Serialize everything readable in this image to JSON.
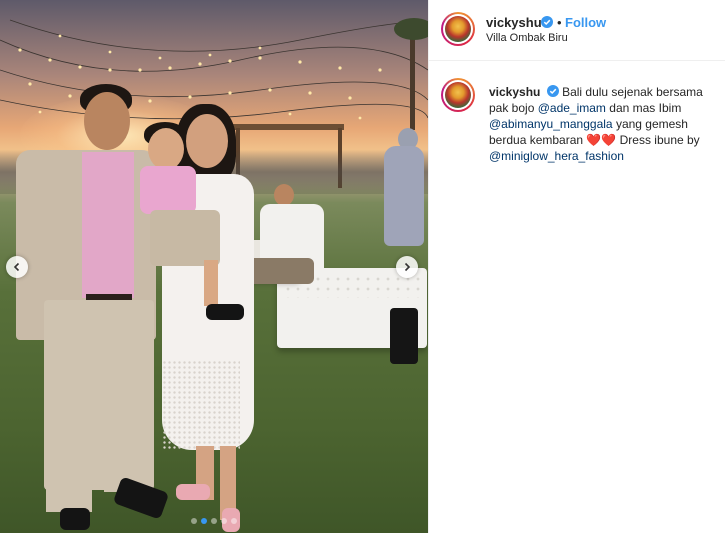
{
  "post": {
    "username": "vickyshu",
    "verified": true,
    "follow_separator": "•",
    "follow_label": "Follow",
    "location": "Villa Ombak Biru"
  },
  "caption": {
    "username": "vickyshu",
    "text_1": "Bali dulu sejenak bersama pak bojo",
    "mention_1": "@ade_imam",
    "text_2": "dan mas Ibim",
    "mention_2": "@abimanyu_manggala",
    "text_3": "yang gemesh berdua kembaran",
    "hearts": "❤️❤️",
    "text_4": "Dress ibune by",
    "mention_3": "@miniglow_hera_fashion"
  },
  "carousel": {
    "total_slides": 5,
    "active_index": 1
  },
  "icons": {
    "prev": "chevron-left-icon",
    "next": "chevron-right-icon",
    "verified": "verified-badge-icon"
  },
  "colors": {
    "accent": "#3897f0",
    "mention": "#003569",
    "text": "#262626"
  }
}
